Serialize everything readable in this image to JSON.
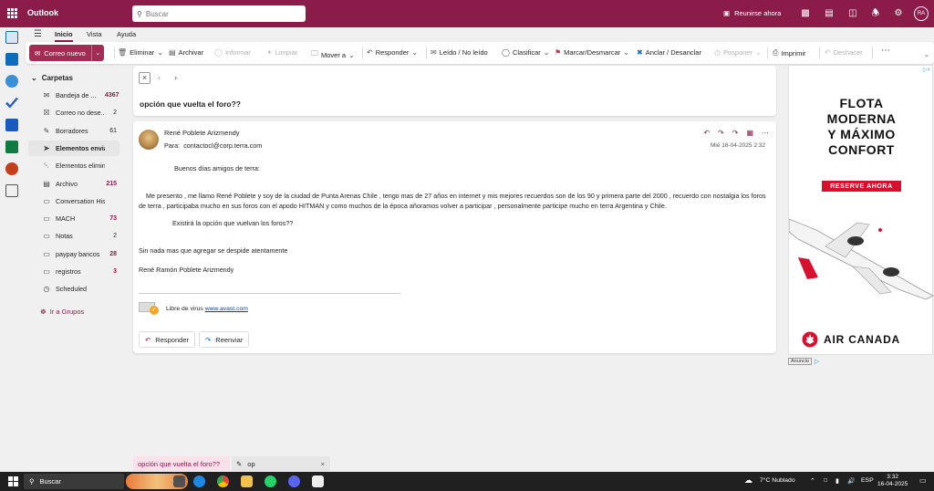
{
  "app": {
    "title": "Outlook",
    "user_initials": "RA"
  },
  "search": {
    "placeholder": "Buscar"
  },
  "topbar": {
    "meet_now": "Reunirse ahora"
  },
  "menu_tabs": [
    "Inicio",
    "Vista",
    "Ayuda"
  ],
  "ribbon": {
    "new_mail": "Correo nuevo",
    "delete": "Eliminar",
    "archive": "Archivar",
    "report": "Informar",
    "sweep": "Limpiar",
    "move_to": "Mover a",
    "reply": "Responder",
    "read_unread": "Leído / No leído",
    "categorize": "Clasificar",
    "flag": "Marcar/Desmarcar",
    "pin": "Anclar / Desanclar",
    "snooze": "Posponer",
    "print": "Imprimir",
    "undo": "Deshacer"
  },
  "folders": {
    "header": "Carpetas",
    "items": [
      {
        "label": "Bandeja de ...",
        "count": "4367",
        "icon": "inbox-icon",
        "bold": true
      },
      {
        "label": "Correo no dese...",
        "count": "2",
        "icon": "junk-icon",
        "bold": false
      },
      {
        "label": "Borradores",
        "count": "61",
        "icon": "drafts-icon",
        "bold": false
      },
      {
        "label": "Elementos enviados",
        "count": "",
        "icon": "sent-icon",
        "bold": false
      },
      {
        "label": "Elementos elimina...",
        "count": "",
        "icon": "trash-icon",
        "bold": false
      },
      {
        "label": "Archivo",
        "count": "215",
        "icon": "archive-icon",
        "bold": true
      },
      {
        "label": "Conversation Histo...",
        "count": "",
        "icon": "folder-icon",
        "bold": false
      },
      {
        "label": "MACH",
        "count": "73",
        "icon": "folder-icon",
        "bold": true
      },
      {
        "label": "Notas",
        "count": "2",
        "icon": "folder-icon",
        "bold": false
      },
      {
        "label": "paypay bancos",
        "count": "28",
        "icon": "folder-icon",
        "bold": true
      },
      {
        "label": "registros",
        "count": "3",
        "icon": "folder-icon",
        "bold": true
      },
      {
        "label": "Scheduled",
        "count": "",
        "icon": "clock-icon",
        "bold": false
      }
    ],
    "groups_link": "Ir a Grupos"
  },
  "message": {
    "subject": "opción que vuelta el foro??",
    "sender": "René Poblete Arizmendy",
    "to_label": "Para:",
    "to": "contactocl@corp.terra.com",
    "date": "Mié 16-04-2025 2:32",
    "greeting": "Buenos días amigos de terra:",
    "paragraph": "Me presento , me llamo René Poblete y soy de la ciudad de Punta Arenas Chile , tengo mas de 27 años en internet y mis mejores recuerdos son de los 90 y primera parte del 2000 , recuerdo con nostalgia los foros de terra , participaba mucho en sus foros con el apodo HITMAN y como muchos de la época añoramos volver a participar , personalmente participe mucho en terra Argentina y Chile.",
    "question": "Existirá la opción que vuelvan los foros??",
    "closing": "Sin nada mas que agregar se despide atentamente",
    "signature": "René Ramón Poblete Arizmendy",
    "virus_text": "Libre de virus",
    "virus_link": "www.avast.com",
    "reply_button": "Responder",
    "forward_button": "Reenviar"
  },
  "ad": {
    "line1": "FLOTA",
    "line2": "MODERNA",
    "line3": "Y MÁXIMO",
    "line4": "CONFORT",
    "cta": "RESERVE AHORA",
    "brand": "AIR CANADA",
    "label": "Anuncio"
  },
  "drafts": [
    {
      "label": "opción que vuelta el foro??"
    },
    {
      "label": "op"
    }
  ],
  "taskbar": {
    "search": "Buscar",
    "weather": "7°C  Nublado",
    "lang": "ESP",
    "time": "3:32",
    "date": "16-04-2025"
  },
  "colors": {
    "brand": "#8b1c4a",
    "accent_button": "#a42b54",
    "ad_red": "#d7102e"
  }
}
